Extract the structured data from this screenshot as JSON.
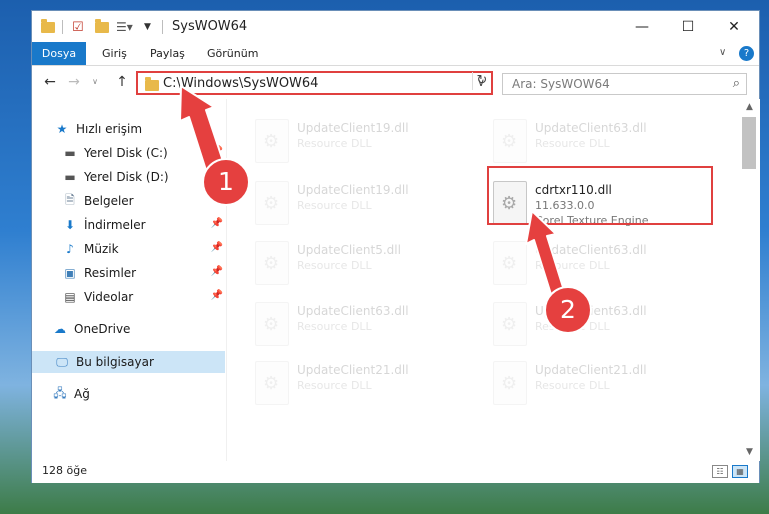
{
  "window": {
    "title": "SysWOW64"
  },
  "ribbon": {
    "tabs": [
      "Dosya",
      "Giriş",
      "Paylaş",
      "Görünüm"
    ],
    "help": "?"
  },
  "address": {
    "path": "C:\\Windows\\SysWOW64",
    "search_placeholder": "Ara: SysWOW64"
  },
  "nav": {
    "items": [
      {
        "label": "Hızlı erişim",
        "icon": "star-icon"
      },
      {
        "label": "Yerel Disk (C:)",
        "icon": "drive-icon"
      },
      {
        "label": "Yerel Disk (D:)",
        "icon": "drive-icon"
      },
      {
        "label": "Belgeler",
        "icon": "document-icon"
      },
      {
        "label": "İndirmeler",
        "icon": "download-icon"
      },
      {
        "label": "Müzik",
        "icon": "music-icon"
      },
      {
        "label": "Resimler",
        "icon": "picture-icon"
      },
      {
        "label": "Videolar",
        "icon": "video-icon"
      },
      {
        "label": "OneDrive",
        "icon": "cloud-icon"
      },
      {
        "label": "Bu bilgisayar",
        "icon": "computer-icon"
      },
      {
        "label": "Ağ",
        "icon": "network-icon"
      }
    ]
  },
  "files": {
    "left": [
      {
        "name": "UpdateClient19.dll",
        "type": "Resource DLL"
      },
      {
        "name": "UpdateClient19.dll",
        "type": "Resource DLL"
      },
      {
        "name": "UpdateClient5.dll",
        "type": "Resource DLL"
      },
      {
        "name": "UpdateClient63.dll",
        "type": "Resource DLL"
      },
      {
        "name": "UpdateClient21.dll",
        "type": "Resource DLL"
      }
    ],
    "right": [
      {
        "name": "UpdateClient63.dll",
        "type": "Resource DLL"
      },
      {
        "name": "UpdateClient63.dll",
        "type": "Resource DLL"
      },
      {
        "name": "UpdateClient63.dll",
        "type": "Resource DLL"
      },
      {
        "name": "UpdateClient21.dll",
        "type": "Resource DLL"
      }
    ],
    "highlighted": {
      "name": "cdrtxr110.dll",
      "version": "11.633.0.0",
      "description": "Corel Texture Engine"
    }
  },
  "status": {
    "count": "128 öğe"
  },
  "annotations": {
    "step1": "1",
    "step2": "2"
  }
}
